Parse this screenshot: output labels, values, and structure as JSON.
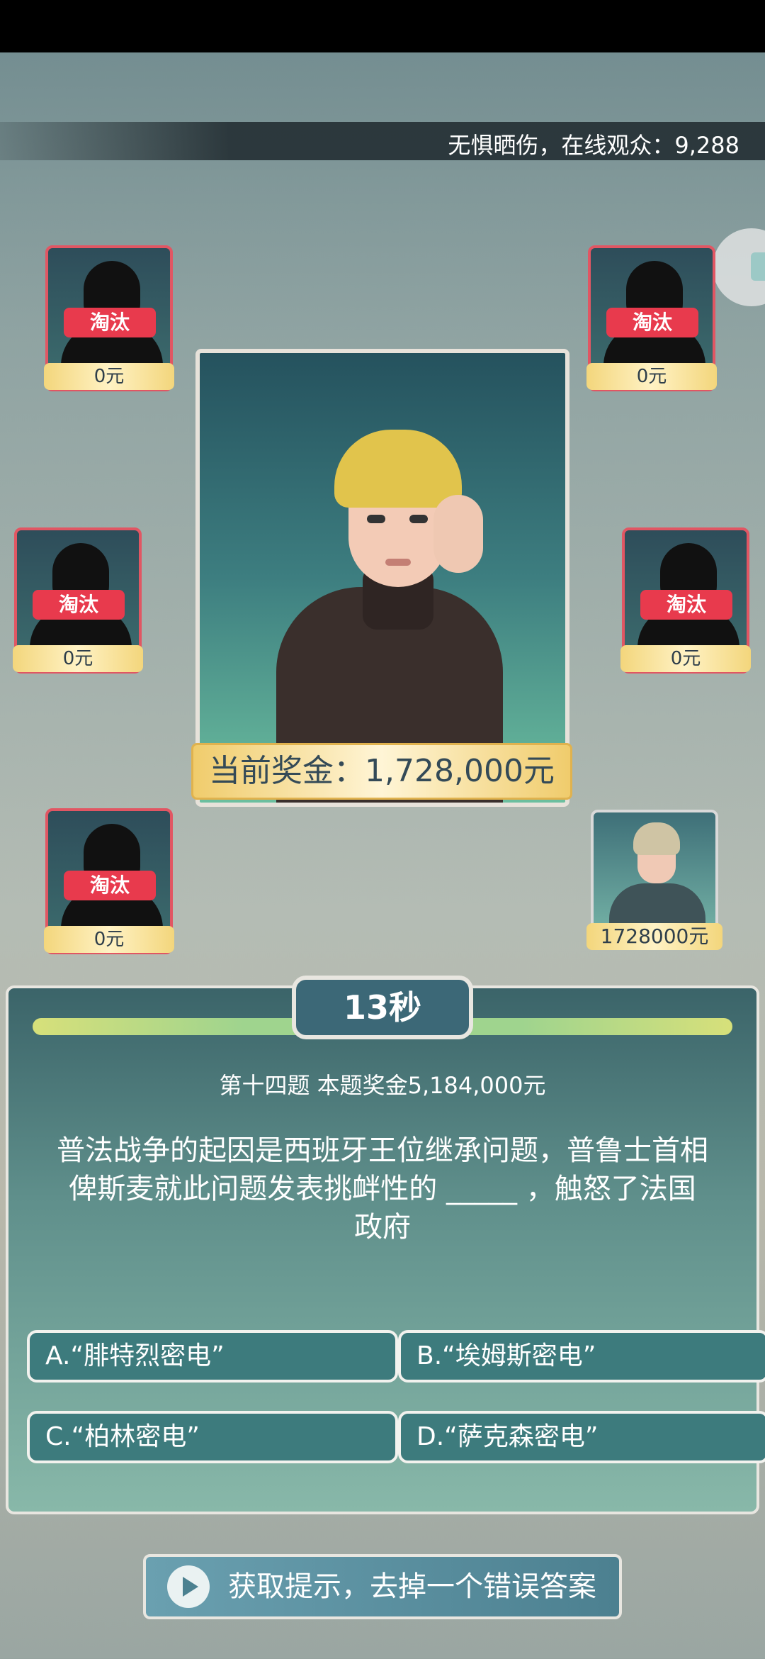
{
  "header": {
    "viewers_text": "无惧晒伤，在线观众：9,288"
  },
  "contestants": [
    {
      "status": "淘汰",
      "money": "0元"
    },
    {
      "status": "淘汰",
      "money": "0元"
    },
    {
      "status": "淘汰",
      "money": "0元"
    },
    {
      "status": "淘汰",
      "money": "0元"
    },
    {
      "status": "淘汰",
      "money": "0元"
    }
  ],
  "host": {
    "current_prize": "当前奖金：1,728,000元"
  },
  "player": {
    "money": "1728000元"
  },
  "question": {
    "timer": "13秒",
    "meta": "第十四题 本题奖金5,184,000元",
    "text": "普法战争的起因是西班牙王位继承问题，普鲁士首相俾斯麦就此问题发表挑衅性的 _____ ，触怒了法国政府",
    "options": [
      {
        "label": "A.“腓特烈密电”"
      },
      {
        "label": "B.“埃姆斯密电”"
      },
      {
        "label": "C.“柏林密电”"
      },
      {
        "label": "D.“萨克森密电”"
      }
    ]
  },
  "hint": {
    "label": "获取提示，去掉一个错误答案"
  }
}
